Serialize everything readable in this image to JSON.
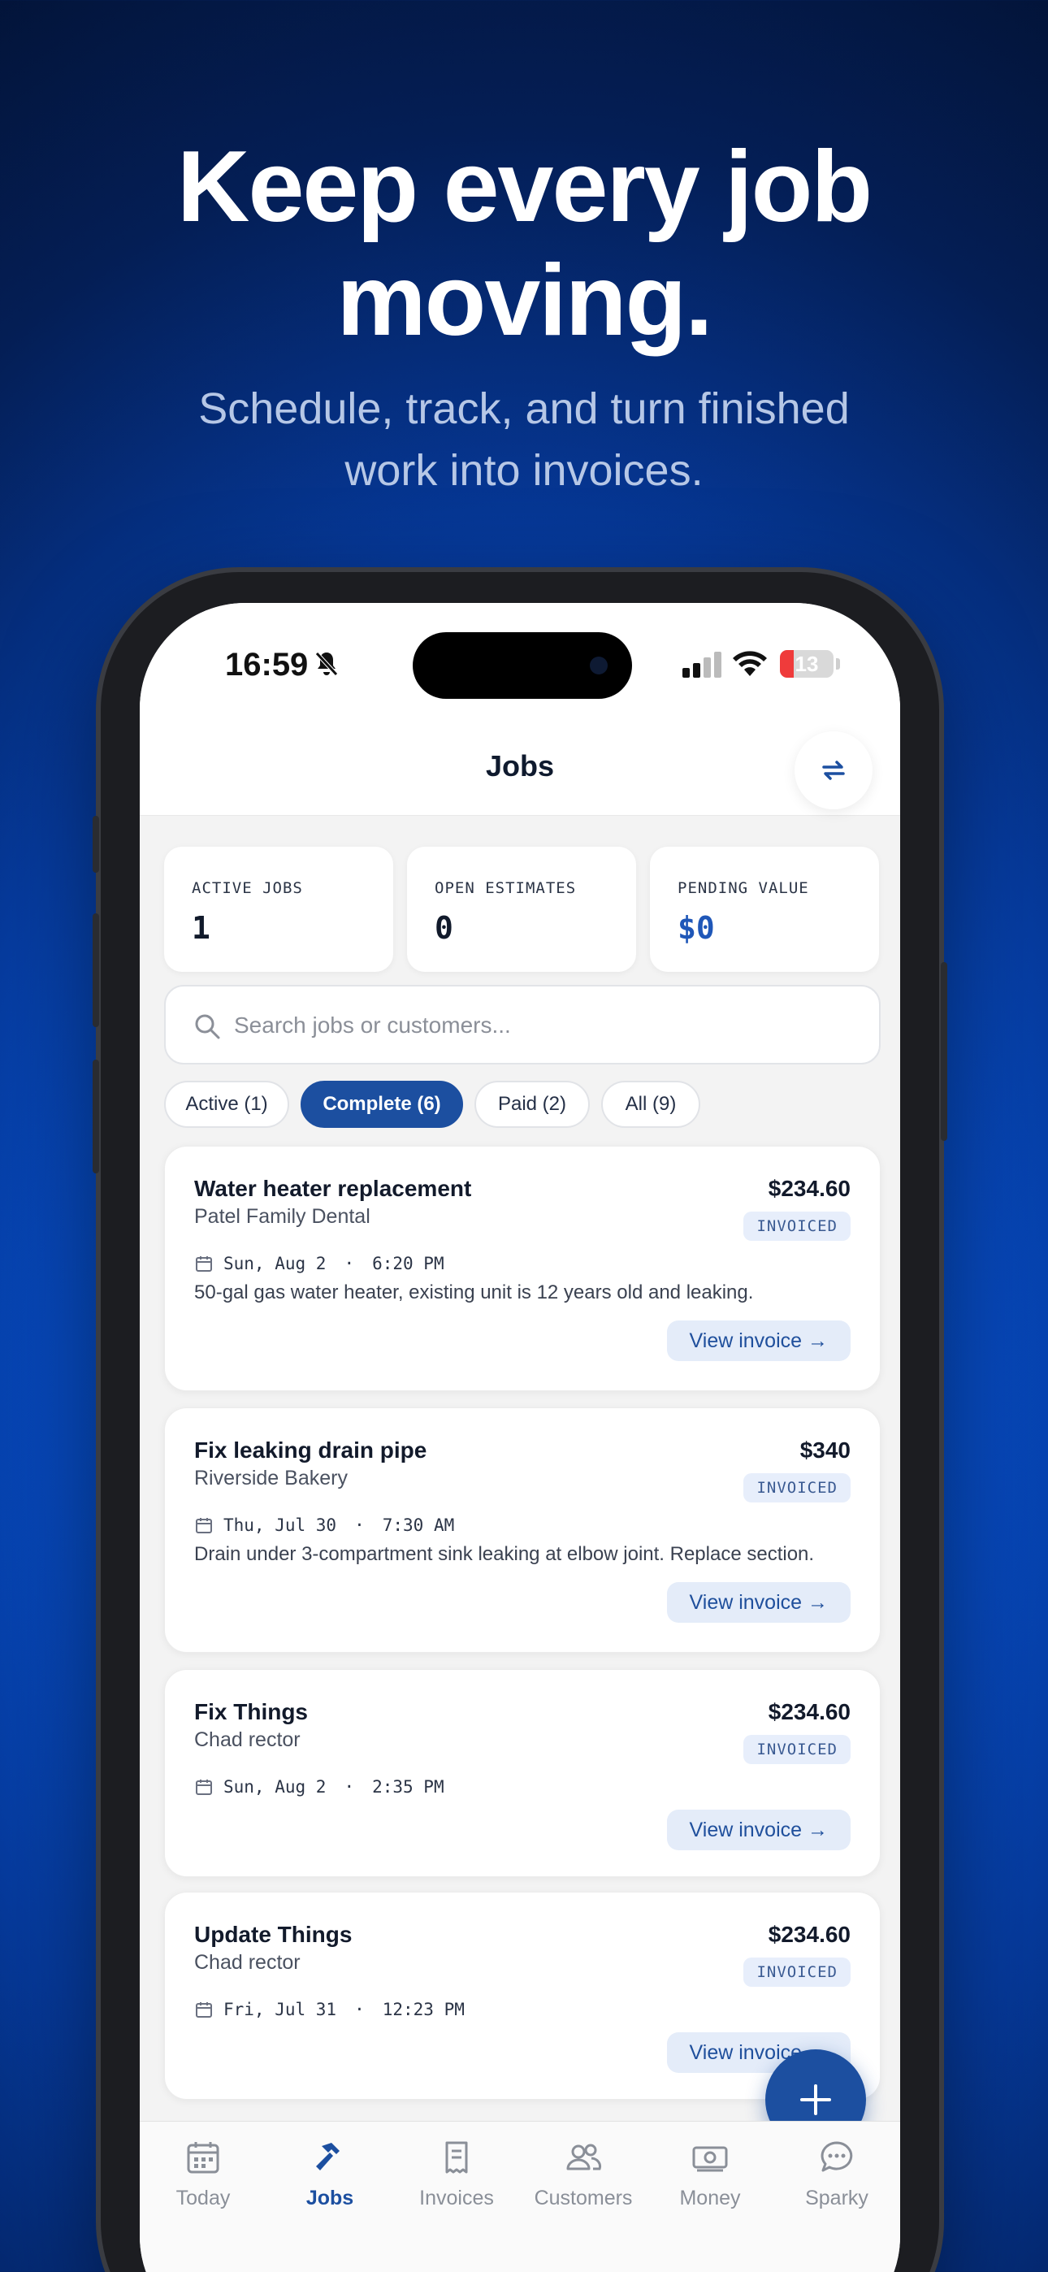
{
  "headline": {
    "line1": "Keep every job",
    "line2": "moving."
  },
  "subhead": {
    "line1": "Schedule, track, and turn finished",
    "line2": "work into invoices."
  },
  "status_bar": {
    "time": "16:59",
    "battery": "13"
  },
  "nav": {
    "title": "Jobs"
  },
  "stats": [
    {
      "label": "ACTIVE JOBS",
      "value": "1"
    },
    {
      "label": "OPEN ESTIMATES",
      "value": "0"
    },
    {
      "label": "PENDING VALUE",
      "value": "$0"
    }
  ],
  "search": {
    "placeholder": "Search jobs or customers..."
  },
  "filters": [
    {
      "label": "Active (1)"
    },
    {
      "label": "Complete (6)",
      "selected": true
    },
    {
      "label": "Paid (2)"
    },
    {
      "label": "All (9)"
    }
  ],
  "jobs": [
    {
      "title": "Water heater replacement",
      "customer": "Patel Family Dental",
      "amount": "$234.60",
      "status": "INVOICED",
      "date": "Sun, Aug 2",
      "time": "6:20 PM",
      "description": "50-gal gas water heater, existing unit is 12 years old and leaking.",
      "action": "View invoice →"
    },
    {
      "title": "Fix leaking drain pipe",
      "customer": "Riverside Bakery",
      "amount": "$340",
      "status": "INVOICED",
      "date": "Thu, Jul 30",
      "time": "7:30 AM",
      "description": "Drain under 3-compartment sink leaking at elbow joint. Replace section.",
      "action": "View invoice →"
    },
    {
      "title": "Fix Things",
      "customer": "Chad rector",
      "amount": "$234.60",
      "status": "INVOICED",
      "date": "Sun, Aug 2",
      "time": "2:35 PM",
      "description": "",
      "action": "View invoice →"
    },
    {
      "title": "Update Things",
      "customer": "Chad rector",
      "amount": "$234.60",
      "status": "INVOICED",
      "date": "Fri, Jul 31",
      "time": "12:23 PM",
      "description": "",
      "action": "View invoice →"
    }
  ],
  "date_separator": "·",
  "tabs": [
    {
      "label": "Today",
      "icon": "calendar-icon"
    },
    {
      "label": "Jobs",
      "icon": "hammer-icon",
      "active": true
    },
    {
      "label": "Invoices",
      "icon": "receipt-icon"
    },
    {
      "label": "Customers",
      "icon": "people-icon"
    },
    {
      "label": "Money",
      "icon": "cash-icon"
    },
    {
      "label": "Sparky",
      "icon": "chat-bubble-icon"
    }
  ],
  "colors": {
    "brand": "#1c4fa0",
    "accent_blue": "#0a6cff",
    "badge_bg": "#e7eefb",
    "battery_low": "#ef3b3b"
  }
}
